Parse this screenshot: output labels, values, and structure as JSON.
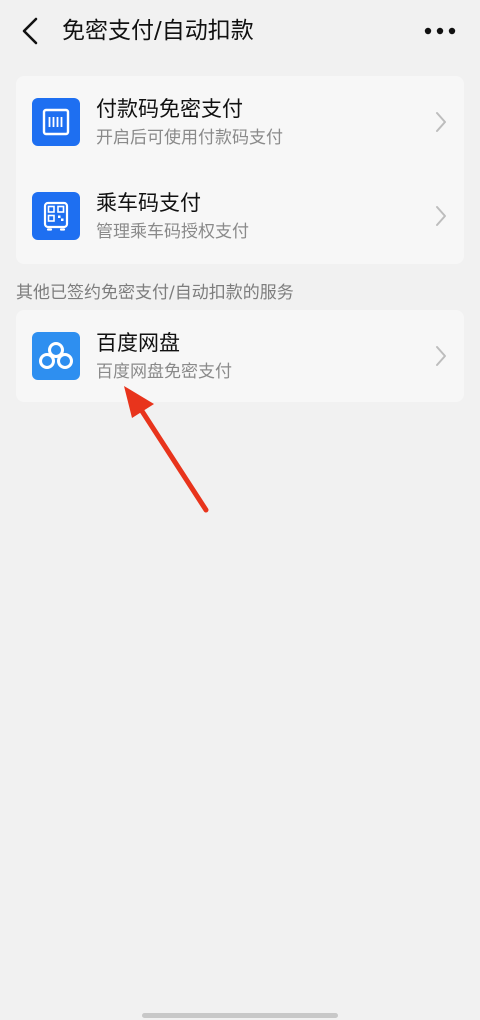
{
  "navbar": {
    "title": "免密支付/自动扣款"
  },
  "main_card": {
    "items": [
      {
        "title": "付款码免密支付",
        "subtitle": "开启后可使用付款码支付",
        "icon": "barcode-icon"
      },
      {
        "title": "乘车码支付",
        "subtitle": "管理乘车码授权支付",
        "icon": "qr-bus-icon"
      }
    ]
  },
  "other_section": {
    "label": "其他已签约免密支付/自动扣款的服务",
    "items": [
      {
        "title": "百度网盘",
        "subtitle": "百度网盘免密支付",
        "icon": "baidu-netdisk-logo"
      }
    ]
  },
  "colors": {
    "accent": "#1e6ff1",
    "annotation": "#e8341c"
  }
}
